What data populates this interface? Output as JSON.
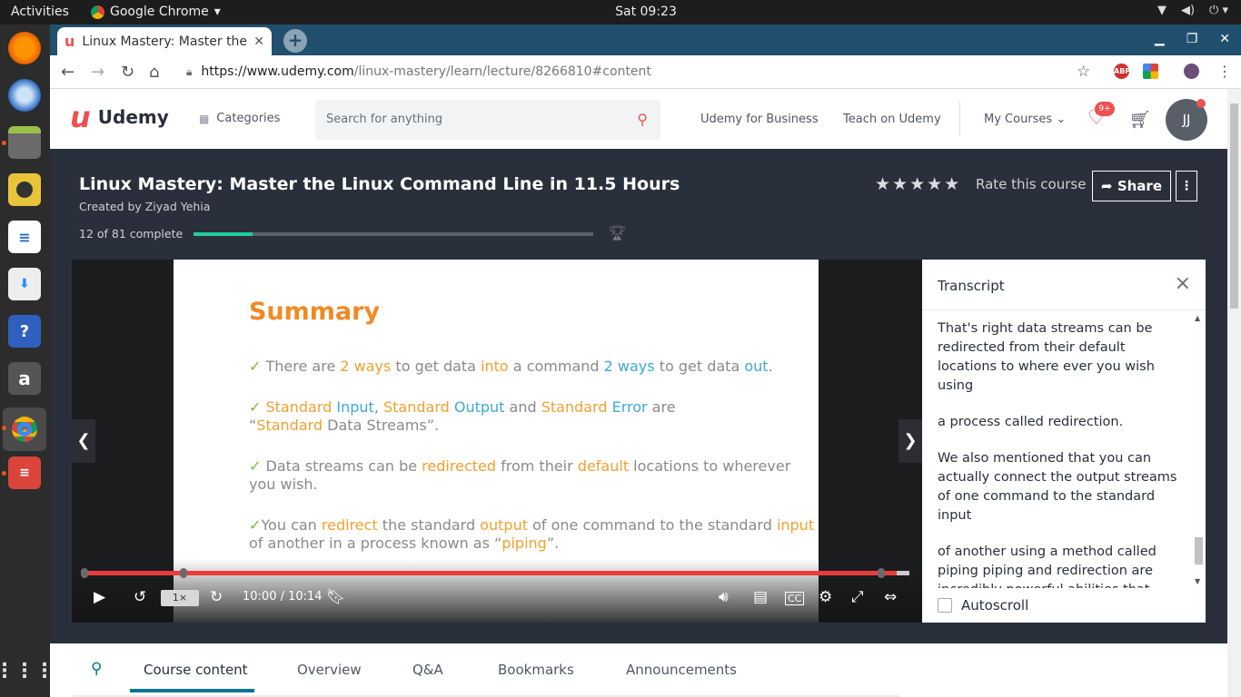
{
  "os": {
    "activities": "Activities",
    "app_name": "Google Chrome",
    "clock": "Sat 09:23",
    "dock_items": [
      "firefox-icon",
      "thunderbird-icon",
      "files-icon",
      "rhythmbox-icon",
      "writer-icon",
      "software-icon",
      "help-icon",
      "amazon-icon",
      "chrome-icon",
      "presentation-icon"
    ],
    "apps_grid": "show-apps-icon"
  },
  "browser": {
    "tab_title": "Linux Mastery: Master the",
    "url_host": "https://www.udemy.com",
    "url_path": "/linux-mastery/learn/lecture/8266810#content",
    "ext_abp": "ABP"
  },
  "header": {
    "logo_text": "Udemy",
    "logo_mark": "u",
    "categories": "Categories",
    "search_placeholder": "Search for anything",
    "business": "Udemy for Business",
    "teach": "Teach on Udemy",
    "my_courses": "My Courses",
    "wishlist_badge": "9+",
    "avatar_initials": "JJ"
  },
  "course": {
    "title": "Linux Mastery: Master the Linux Command Line in 11.5 Hours",
    "created_by": "Created by Ziyad Yehia",
    "progress_text": "12 of 81 complete",
    "progress_fraction": 0.148,
    "stars": "★★★★★",
    "rate": "Rate this course",
    "share": "Share",
    "more": "⋮"
  },
  "slide": {
    "heading": "Summary",
    "b1": {
      "a": "There are ",
      "b": "2 ways",
      "c": " to get data ",
      "d": "into",
      "e": " a command ",
      "f": "2 ways",
      "g": " to get data ",
      "h": "out",
      "i": "."
    },
    "b2": {
      "a": "Standard ",
      "b": "Input",
      ",": ", ",
      "c": "Standard ",
      "d": "Output",
      "e": " and ",
      "f": "Standard ",
      "g": "Error",
      "h": " are",
      "i": "“",
      "j": "Standard",
      "k": " Data Streams”."
    },
    "b3": {
      "a": "Data streams can be ",
      "b": "redirected",
      "c": " from their ",
      "d": "default",
      "e": " locations to wherever",
      "f": "you wish."
    },
    "b4": {
      "a": "You can ",
      "b": "redirect",
      "c": " the standard ",
      "d": "output",
      "e": " of one command to the standard ",
      "f": "input",
      "g": "of another in a process known as “",
      "h": "piping",
      "i": "”."
    }
  },
  "player": {
    "played_fraction": 0.985,
    "speed": "1×",
    "time": "10:00 / 10:14"
  },
  "transcript": {
    "title": "Transcript",
    "paragraphs": [
      "That's right data streams can be redirected from their default locations to where ever you wish using",
      "a process called redirection.",
      "We also mentioned that you can actually connect the output streams of one command to the standard input",
      "of another using a method called piping piping and redirection are incredibly powerful abilities that"
    ],
    "autoscroll": "Autoscroll"
  },
  "tabs": [
    "Course content",
    "Overview",
    "Q&A",
    "Bookmarks",
    "Announcements"
  ],
  "colors": {
    "brand": "#ec5252",
    "dark": "#29303b",
    "progress": "#1ecf9e",
    "accent": "#007791",
    "slide_orange": "#f08a24",
    "slide_blue": "#3ea9d6"
  }
}
